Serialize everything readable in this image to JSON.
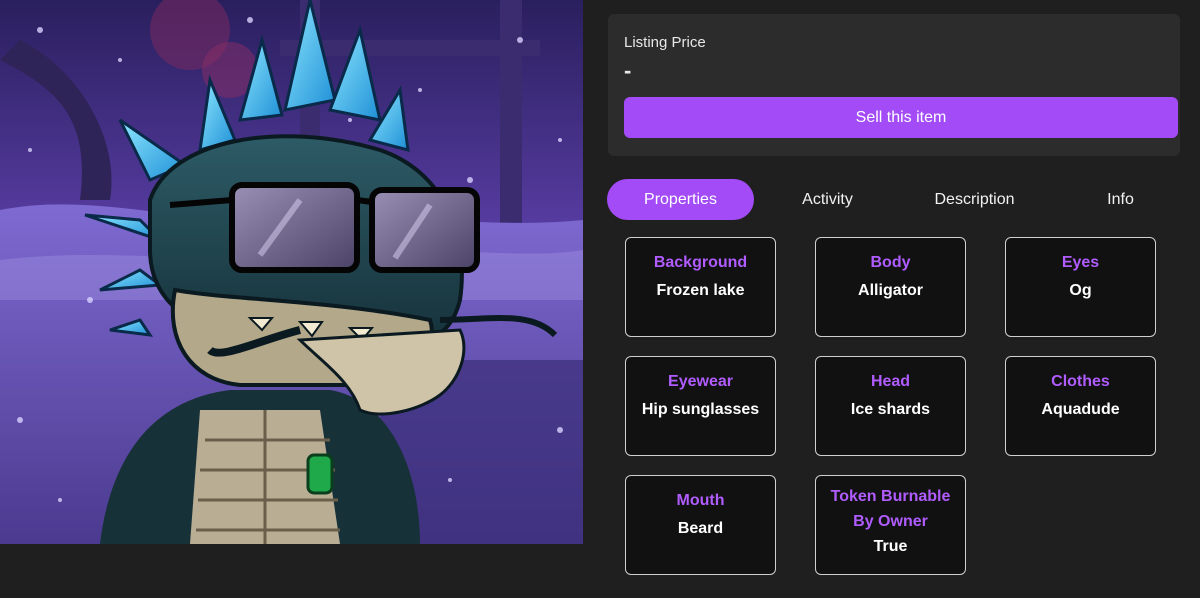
{
  "listing": {
    "price_label": "Listing Price",
    "price_value": "-",
    "sell_button": "Sell this item"
  },
  "tabs": [
    {
      "label": "Properties",
      "active": true
    },
    {
      "label": "Activity",
      "active": false
    },
    {
      "label": "Description",
      "active": false
    },
    {
      "label": "Info",
      "active": false
    }
  ],
  "properties": [
    {
      "trait": "Background",
      "value": "Frozen lake"
    },
    {
      "trait": "Body",
      "value": "Alligator"
    },
    {
      "trait": "Eyes",
      "value": "Og"
    },
    {
      "trait": "Eyewear",
      "value": "Hip sunglasses"
    },
    {
      "trait": "Head",
      "value": "Ice shards"
    },
    {
      "trait": "Clothes",
      "value": "Aquadude"
    },
    {
      "trait": "Mouth",
      "value": "Beard"
    },
    {
      "trait": "Token Burnable By Owner",
      "value": "True"
    }
  ],
  "colors": {
    "accent": "#a24bf6",
    "trait_label": "#b05cff",
    "page_bg": "#1f1f1f",
    "card_bg": "#2c2c2c"
  },
  "icons": {
    "artwork": "nft-alligator-artwork"
  }
}
